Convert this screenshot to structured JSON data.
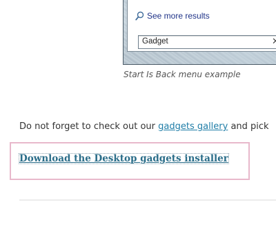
{
  "start_menu": {
    "see_more_label": "See more results",
    "search_value": "Gadget",
    "clear_glyph": "✕",
    "icons": {
      "search": "magnifier-icon"
    }
  },
  "caption": "Start Is Back menu example",
  "paragraph": {
    "before": "Do not forget to check out our ",
    "link": "gadgets gallery",
    "after": " and pick"
  },
  "download_link": "Download the Desktop gadgets installer",
  "colors": {
    "link": "#1f7da7",
    "download_link": "#2a6d89",
    "highlight_border": "#e8b8cb",
    "see_more_text": "#1e3287"
  }
}
